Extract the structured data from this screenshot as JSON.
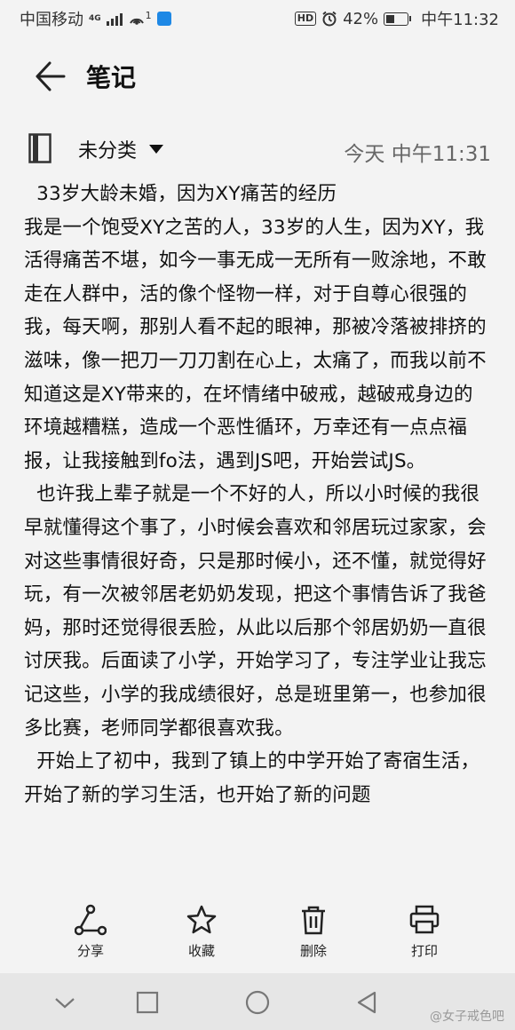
{
  "status_bar": {
    "carrier": "中国移动",
    "network": "4G",
    "hotspot_count": "1",
    "battery_percent": "42%",
    "battery_level": 0.42,
    "time": "中午11:32"
  },
  "header": {
    "title": "笔记"
  },
  "meta": {
    "category": "未分类",
    "timestamp": "今天 中午11:31"
  },
  "note": {
    "paragraphs": [
      "  33岁大龄未婚，因为XY痛苦的经历\n我是一个饱受XY之苦的人，33岁的人生，因为XY，我活得痛苦不堪，如今一事无成一无所有一败涂地，不敢走在人群中，活的像个怪物一样，对于自尊心很强的我，每天啊，那别人看不起的眼神，那被冷落被排挤的滋味，像一把刀一刀刀割在心上，太痛了，而我以前不知道这是XY带来的，在坏情绪中破戒，越破戒身边的环境越糟糕，造成一个恶性循环，万幸还有一点点福报，让我接触到fo法，遇到JS吧，开始尝试JS。",
      "  也许我上辈子就是一个不好的人，所以小时候的我很早就懂得这个事了，小时候会喜欢和邻居玩过家家，会对这些事情很好奇，只是那时候小，还不懂，就觉得好玩，有一次被邻居老奶奶发现，把这个事情告诉了我爸妈，那时还觉得很丢脸，从此以后那个邻居奶奶一直很讨厌我。后面读了小学，开始学习了，专注学业让我忘记这些，小学的我成绩很好，总是班里第一，也参加很多比赛，老师同学都很喜欢我。",
      "  开始上了初中，我到了镇上的中学开始了寄宿生活，开始了新的学习生活，也开始了新的问题"
    ]
  },
  "toolbar": {
    "share": "分享",
    "favorite": "收藏",
    "delete": "删除",
    "print": "打印"
  },
  "watermark": "@女子戒色吧",
  "icons": {
    "back": "arrow-left-icon",
    "notebook": "notebook-icon",
    "share": "share-icon",
    "favorite": "star-icon",
    "delete": "trash-icon",
    "print": "printer-icon"
  }
}
